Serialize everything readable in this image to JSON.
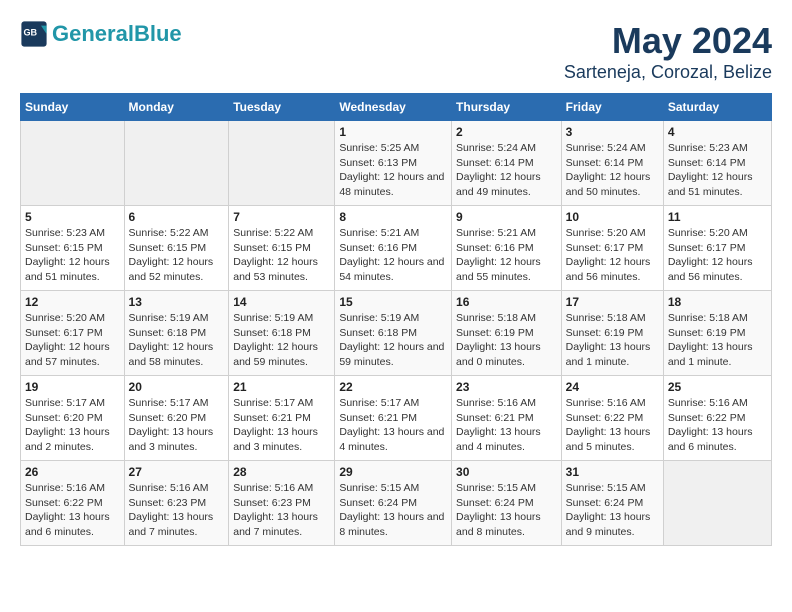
{
  "header": {
    "logo_line1": "General",
    "logo_line2": "Blue",
    "title": "May 2024",
    "subtitle": "Sarteneja, Corozal, Belize"
  },
  "weekdays": [
    "Sunday",
    "Monday",
    "Tuesday",
    "Wednesday",
    "Thursday",
    "Friday",
    "Saturday"
  ],
  "weeks": [
    [
      {
        "day": "",
        "sunrise": "",
        "sunset": "",
        "daylight": ""
      },
      {
        "day": "",
        "sunrise": "",
        "sunset": "",
        "daylight": ""
      },
      {
        "day": "",
        "sunrise": "",
        "sunset": "",
        "daylight": ""
      },
      {
        "day": "1",
        "sunrise": "Sunrise: 5:25 AM",
        "sunset": "Sunset: 6:13 PM",
        "daylight": "Daylight: 12 hours and 48 minutes."
      },
      {
        "day": "2",
        "sunrise": "Sunrise: 5:24 AM",
        "sunset": "Sunset: 6:14 PM",
        "daylight": "Daylight: 12 hours and 49 minutes."
      },
      {
        "day": "3",
        "sunrise": "Sunrise: 5:24 AM",
        "sunset": "Sunset: 6:14 PM",
        "daylight": "Daylight: 12 hours and 50 minutes."
      },
      {
        "day": "4",
        "sunrise": "Sunrise: 5:23 AM",
        "sunset": "Sunset: 6:14 PM",
        "daylight": "Daylight: 12 hours and 51 minutes."
      }
    ],
    [
      {
        "day": "5",
        "sunrise": "Sunrise: 5:23 AM",
        "sunset": "Sunset: 6:15 PM",
        "daylight": "Daylight: 12 hours and 51 minutes."
      },
      {
        "day": "6",
        "sunrise": "Sunrise: 5:22 AM",
        "sunset": "Sunset: 6:15 PM",
        "daylight": "Daylight: 12 hours and 52 minutes."
      },
      {
        "day": "7",
        "sunrise": "Sunrise: 5:22 AM",
        "sunset": "Sunset: 6:15 PM",
        "daylight": "Daylight: 12 hours and 53 minutes."
      },
      {
        "day": "8",
        "sunrise": "Sunrise: 5:21 AM",
        "sunset": "Sunset: 6:16 PM",
        "daylight": "Daylight: 12 hours and 54 minutes."
      },
      {
        "day": "9",
        "sunrise": "Sunrise: 5:21 AM",
        "sunset": "Sunset: 6:16 PM",
        "daylight": "Daylight: 12 hours and 55 minutes."
      },
      {
        "day": "10",
        "sunrise": "Sunrise: 5:20 AM",
        "sunset": "Sunset: 6:17 PM",
        "daylight": "Daylight: 12 hours and 56 minutes."
      },
      {
        "day": "11",
        "sunrise": "Sunrise: 5:20 AM",
        "sunset": "Sunset: 6:17 PM",
        "daylight": "Daylight: 12 hours and 56 minutes."
      }
    ],
    [
      {
        "day": "12",
        "sunrise": "Sunrise: 5:20 AM",
        "sunset": "Sunset: 6:17 PM",
        "daylight": "Daylight: 12 hours and 57 minutes."
      },
      {
        "day": "13",
        "sunrise": "Sunrise: 5:19 AM",
        "sunset": "Sunset: 6:18 PM",
        "daylight": "Daylight: 12 hours and 58 minutes."
      },
      {
        "day": "14",
        "sunrise": "Sunrise: 5:19 AM",
        "sunset": "Sunset: 6:18 PM",
        "daylight": "Daylight: 12 hours and 59 minutes."
      },
      {
        "day": "15",
        "sunrise": "Sunrise: 5:19 AM",
        "sunset": "Sunset: 6:18 PM",
        "daylight": "Daylight: 12 hours and 59 minutes."
      },
      {
        "day": "16",
        "sunrise": "Sunrise: 5:18 AM",
        "sunset": "Sunset: 6:19 PM",
        "daylight": "Daylight: 13 hours and 0 minutes."
      },
      {
        "day": "17",
        "sunrise": "Sunrise: 5:18 AM",
        "sunset": "Sunset: 6:19 PM",
        "daylight": "Daylight: 13 hours and 1 minute."
      },
      {
        "day": "18",
        "sunrise": "Sunrise: 5:18 AM",
        "sunset": "Sunset: 6:19 PM",
        "daylight": "Daylight: 13 hours and 1 minute."
      }
    ],
    [
      {
        "day": "19",
        "sunrise": "Sunrise: 5:17 AM",
        "sunset": "Sunset: 6:20 PM",
        "daylight": "Daylight: 13 hours and 2 minutes."
      },
      {
        "day": "20",
        "sunrise": "Sunrise: 5:17 AM",
        "sunset": "Sunset: 6:20 PM",
        "daylight": "Daylight: 13 hours and 3 minutes."
      },
      {
        "day": "21",
        "sunrise": "Sunrise: 5:17 AM",
        "sunset": "Sunset: 6:21 PM",
        "daylight": "Daylight: 13 hours and 3 minutes."
      },
      {
        "day": "22",
        "sunrise": "Sunrise: 5:17 AM",
        "sunset": "Sunset: 6:21 PM",
        "daylight": "Daylight: 13 hours and 4 minutes."
      },
      {
        "day": "23",
        "sunrise": "Sunrise: 5:16 AM",
        "sunset": "Sunset: 6:21 PM",
        "daylight": "Daylight: 13 hours and 4 minutes."
      },
      {
        "day": "24",
        "sunrise": "Sunrise: 5:16 AM",
        "sunset": "Sunset: 6:22 PM",
        "daylight": "Daylight: 13 hours and 5 minutes."
      },
      {
        "day": "25",
        "sunrise": "Sunrise: 5:16 AM",
        "sunset": "Sunset: 6:22 PM",
        "daylight": "Daylight: 13 hours and 6 minutes."
      }
    ],
    [
      {
        "day": "26",
        "sunrise": "Sunrise: 5:16 AM",
        "sunset": "Sunset: 6:22 PM",
        "daylight": "Daylight: 13 hours and 6 minutes."
      },
      {
        "day": "27",
        "sunrise": "Sunrise: 5:16 AM",
        "sunset": "Sunset: 6:23 PM",
        "daylight": "Daylight: 13 hours and 7 minutes."
      },
      {
        "day": "28",
        "sunrise": "Sunrise: 5:16 AM",
        "sunset": "Sunset: 6:23 PM",
        "daylight": "Daylight: 13 hours and 7 minutes."
      },
      {
        "day": "29",
        "sunrise": "Sunrise: 5:15 AM",
        "sunset": "Sunset: 6:24 PM",
        "daylight": "Daylight: 13 hours and 8 minutes."
      },
      {
        "day": "30",
        "sunrise": "Sunrise: 5:15 AM",
        "sunset": "Sunset: 6:24 PM",
        "daylight": "Daylight: 13 hours and 8 minutes."
      },
      {
        "day": "31",
        "sunrise": "Sunrise: 5:15 AM",
        "sunset": "Sunset: 6:24 PM",
        "daylight": "Daylight: 13 hours and 9 minutes."
      },
      {
        "day": "",
        "sunrise": "",
        "sunset": "",
        "daylight": ""
      }
    ]
  ]
}
